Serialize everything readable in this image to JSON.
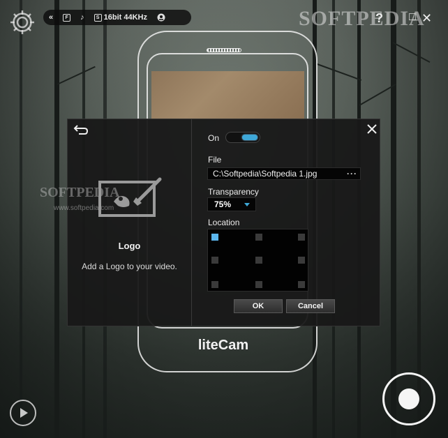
{
  "app": {
    "brand": "liteCam",
    "watermark_top": "SOFTPEDIA",
    "watermark_mid": "SOFTPEDIA",
    "watermark_url": "www.softpedia.com"
  },
  "topbar": {
    "audio_format": "16bit 44KHz",
    "icons": [
      "collapse-icon",
      "screen-mode-icon",
      "music-note-icon",
      "sound-quality-icon",
      "webcam-off-icon"
    ]
  },
  "window_controls": {
    "help": "?",
    "maximize": "□",
    "close": "✕"
  },
  "dialog": {
    "feature_title": "Logo",
    "feature_description": "Add a Logo to your video.",
    "on_label": "On",
    "toggle_on": true,
    "file_label": "File",
    "file_value": "C:\\Softpedia\\Softpedia 1.jpg",
    "file_more": "···",
    "transparency_label": "Transparency",
    "transparency_value": "75%",
    "location_label": "Location",
    "location_selected": "top-left",
    "ok_label": "OK",
    "cancel_label": "Cancel"
  },
  "colors": {
    "accent": "#3ea8d8",
    "dialog_bg": "#181818",
    "grid_active": "#5bb6ee"
  }
}
